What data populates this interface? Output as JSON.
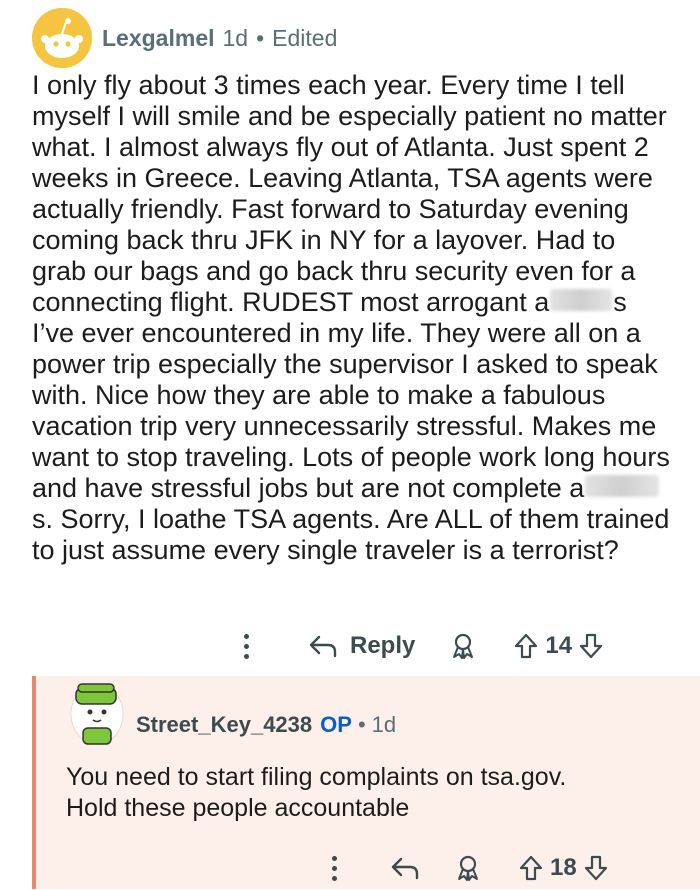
{
  "comment": {
    "author": "Lexgalmel",
    "age": "1d",
    "separator": "•",
    "edited": "Edited",
    "body_part1": "I only fly about 3 times each year. Every time I tell myself I will smile and be especially patient no matter what. I almost always fly out of Atlanta. Just spent 2 weeks in Greece. Leaving Atlanta, TSA agents were actually friendly. Fast forward to Saturday evening coming back thru JFK in NY for a layover. Had to grab our bags and go back thru security even for a connecting flight. RUDEST most arrogant a",
    "body_part2": "s I’ve ever encountered in my life. They were all on a power trip especially the supervisor I asked to speak with. Nice how they are able to make a fabulous vacation trip very unnecessarily stressful. Makes me want to stop traveling. Lots of people work long hours and have stressful jobs but are not complete a",
    "body_part3": "s. Sorry, I loathe TSA agents. Are ALL of them trained to just assume every single traveler is a terrorist?",
    "reply_label": "Reply",
    "vote_count": "14"
  },
  "reply": {
    "author": "Street_Key_4238",
    "op_badge": "OP",
    "separator": "•",
    "age": "1d",
    "body_line1": "You need to start filing complaints on tsa.gov.",
    "body_line2": "Hold these people accountable",
    "vote_count": "18"
  },
  "colors": {
    "accent_orange": "#e8876a",
    "reply_bg": "#fdf0ea",
    "op_blue": "#0a5fc7",
    "avatar_yellow": "#f5c542"
  },
  "icons": [
    "snoo-avatar-icon",
    "more-options-icon",
    "reply-arrow-icon",
    "award-icon",
    "upvote-icon",
    "downvote-icon",
    "user-avatar-icon"
  ]
}
